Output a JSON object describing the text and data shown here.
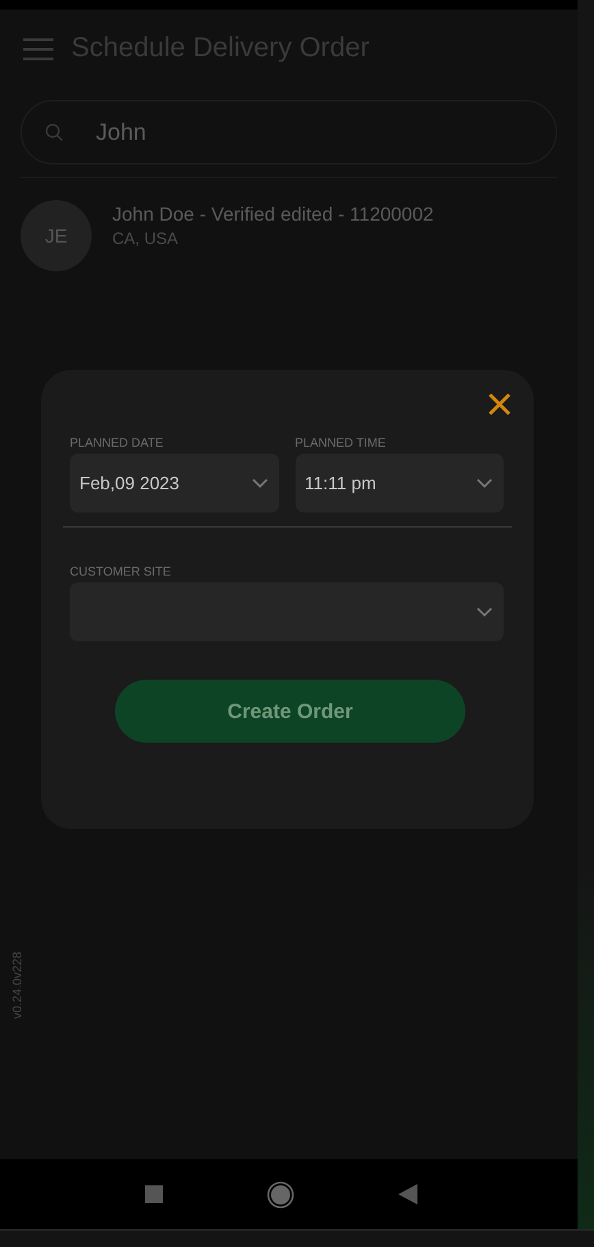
{
  "header": {
    "title": "Schedule Delivery Order"
  },
  "search": {
    "value": "John"
  },
  "results": [
    {
      "initials": "JE",
      "name": "John Doe - Verified edited - 11200002",
      "location": "CA, USA"
    }
  ],
  "dialog": {
    "fields": [
      {
        "label": "PLANNED DATE",
        "value": "Feb,09 2023"
      },
      {
        "label": "PLANNED TIME",
        "value": "11:11 pm"
      }
    ],
    "site": {
      "label": "CUSTOMER SITE"
    },
    "button": "Create Order"
  },
  "version": "v0.24.0v228"
}
